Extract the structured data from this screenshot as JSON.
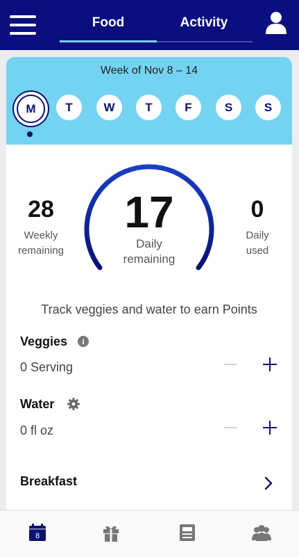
{
  "header": {
    "tabs": [
      {
        "label": "Food",
        "active": true
      },
      {
        "label": "Activity",
        "active": false
      }
    ],
    "menu_icon": "hamburger-menu-icon",
    "profile_icon": "user-icon"
  },
  "week": {
    "label": "Week of Nov 8 – 14",
    "days": [
      "M",
      "T",
      "W",
      "T",
      "F",
      "S",
      "S"
    ],
    "selected_index": 0
  },
  "points": {
    "weekly_remaining": "28",
    "weekly_label_1": "Weekly",
    "weekly_label_2": "remaining",
    "daily_remaining": "17",
    "daily_label_1": "Daily",
    "daily_label_2": "remaining",
    "daily_used": "0",
    "used_label_1": "Daily",
    "used_label_2": "used"
  },
  "tracking": {
    "earn_text": "Track veggies and water to earn Points",
    "veggies": {
      "title": "Veggies",
      "value": "0 Serving"
    },
    "water": {
      "title": "Water",
      "value": "0 fl oz"
    },
    "breakfast": {
      "title": "Breakfast"
    }
  },
  "bottom_nav": {
    "calendar_day": "8",
    "items": [
      "calendar-icon",
      "gift-icon",
      "journal-icon",
      "community-icon"
    ]
  },
  "colors": {
    "header": "#0a0e7e",
    "week_band": "#74d3f1",
    "accent": "#0a1170",
    "tab_underline": "#7fd3f2"
  }
}
